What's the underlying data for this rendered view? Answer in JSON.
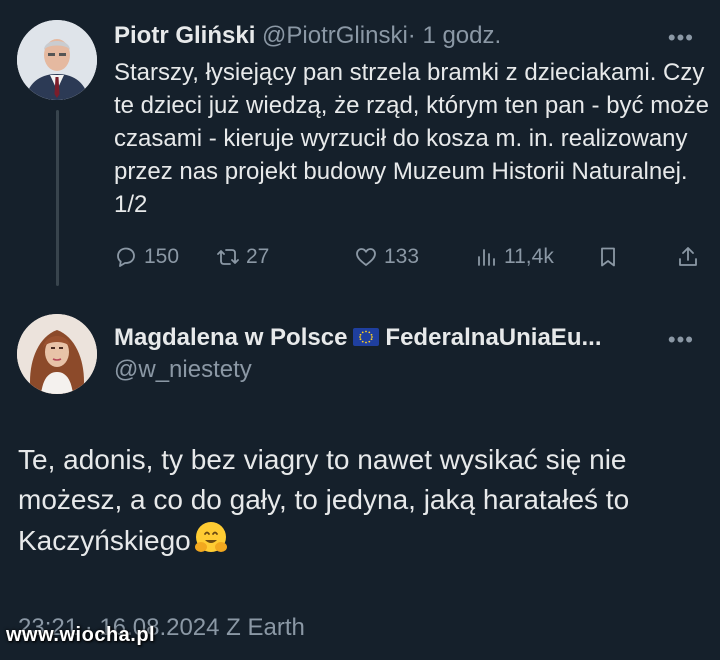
{
  "tweet1": {
    "author_name": "Piotr Gliński",
    "handle": "@PiotrGlinski",
    "time": "· 1 godz.",
    "more_icon": "more-horizontal-icon",
    "text": "Starszy, łysiejący pan strzela bramki z dzieciakami. Czy te dzieci już wiedzą, że rząd, którym ten pan - być może czasami - kieruje wyrzucił do kosza m. in. realizowany przez nas projekt budowy Muzeum Historii Naturalnej. 1/2",
    "replies": "150",
    "reposts": "27",
    "likes": "133",
    "views": "11,4k"
  },
  "tweet2": {
    "author_name": "Magdalena w Polsce",
    "author_name_suffix": "FederalnaUniaEu...",
    "handle": "@w_niestety",
    "text": "Te, adonis, ty bez viagry to nawet wysikać się nie możesz, a co do gały, to jedyna, jaką haratałeś to Kaczyńskiego",
    "emoji": "hugging-face-emoji",
    "timestamp": "23:21 · 16.08.2024 Z Earth"
  },
  "watermark": "www.wiocha.pl",
  "colors": {
    "background": "#15202b",
    "text": "#e7e9ea",
    "secondary": "#8b98a5",
    "divider": "#38444d"
  }
}
